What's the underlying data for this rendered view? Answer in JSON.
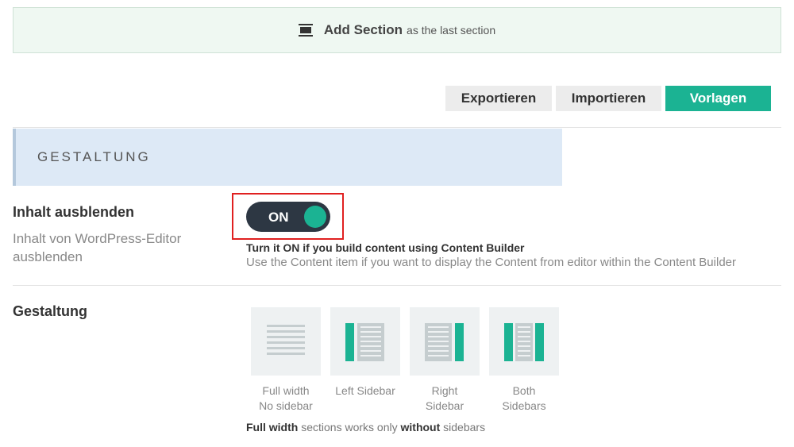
{
  "add_section": {
    "icon": "section-icon",
    "strong": "Add Section",
    "rest": "as the last section"
  },
  "toolbar": {
    "export_label": "Exportieren",
    "import_label": "Importieren",
    "templates_label": "Vorlagen"
  },
  "heading": "GESTALTUNG",
  "hide_content": {
    "title": "Inhalt ausblenden",
    "description": "Inhalt von WordPress-Editor ausblenden",
    "toggle_state": "ON",
    "hint_bold": "Turn it ON if you build content using Content Builder",
    "hint": "Use the Content item if you want to display the Content from editor within the Content Builder"
  },
  "layout": {
    "title": "Gestaltung",
    "options": [
      {
        "line1": "Full width",
        "line2": "No sidebar"
      },
      {
        "line1": "Left Sidebar",
        "line2": ""
      },
      {
        "line1": "Right",
        "line2": "Sidebar"
      },
      {
        "line1": "Both",
        "line2": "Sidebars"
      }
    ],
    "note": {
      "b1": "Full width",
      "t1": " sections works only ",
      "b2": "without",
      "t2": " sidebars"
    }
  },
  "colors": {
    "accent": "#1bb393",
    "toggle_bg": "#2d3743",
    "highlight": "#e02020"
  }
}
